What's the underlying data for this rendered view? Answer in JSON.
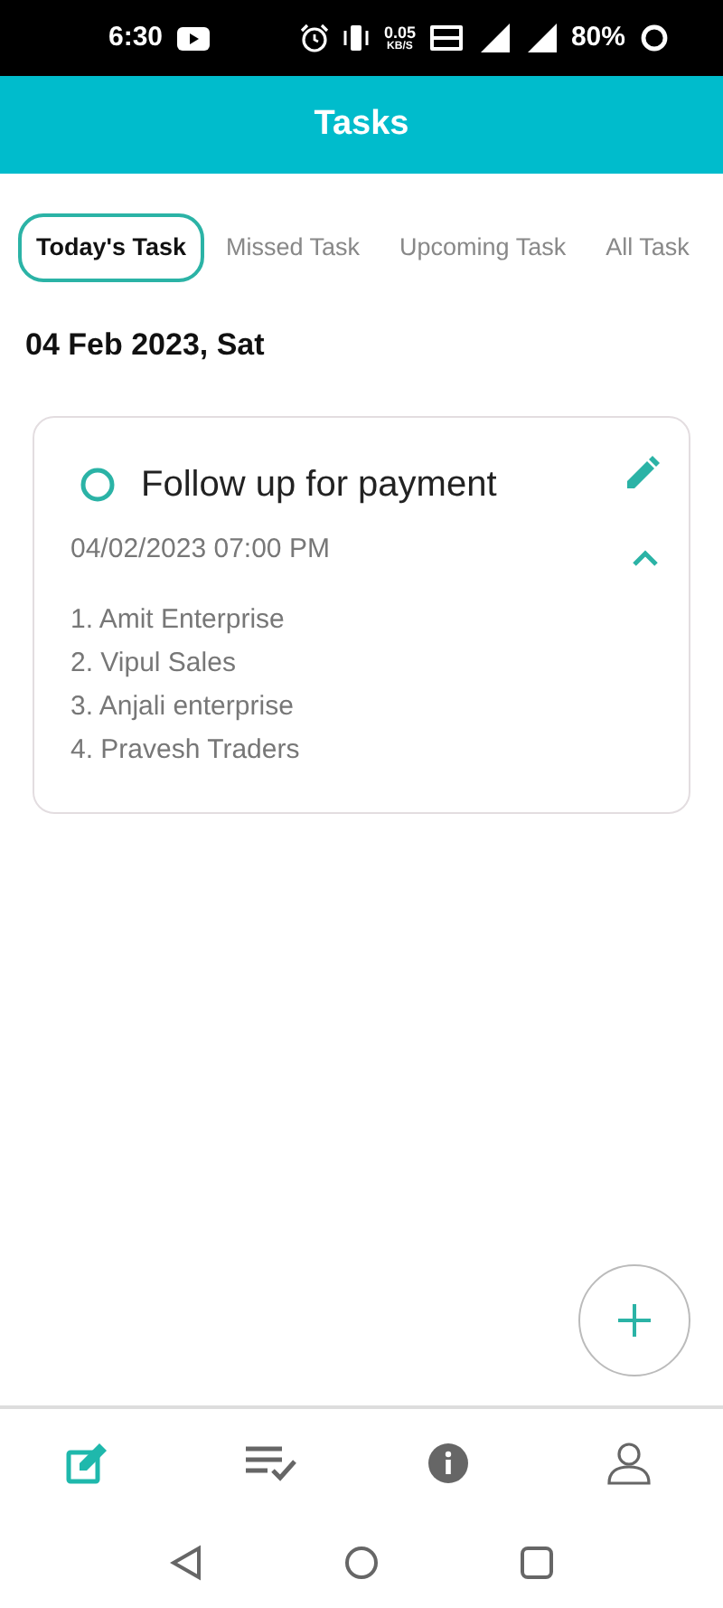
{
  "status_bar": {
    "time": "6:30",
    "speed": "0.05",
    "speed_unit": "KB/S",
    "battery": "80%"
  },
  "header": {
    "title": "Tasks"
  },
  "tabs": [
    {
      "label": "Today's Task",
      "selected": true
    },
    {
      "label": "Missed Task",
      "selected": false
    },
    {
      "label": "Upcoming Task",
      "selected": false
    },
    {
      "label": "All Task",
      "selected": false
    }
  ],
  "date_heading": "04 Feb 2023, Sat",
  "tasks": [
    {
      "title": "Follow up for payment",
      "done": false,
      "expanded": true,
      "datetime": "04/02/2023 07:00 PM",
      "items": [
        "1. Amit Enterprise",
        "2. Vipul Sales",
        "3. Anjali enterprise",
        "4. Pravesh Traders"
      ]
    }
  ],
  "bottom_nav": [
    {
      "kind": "edit",
      "selected": true
    },
    {
      "kind": "checklist",
      "selected": false
    },
    {
      "kind": "info",
      "selected": false
    },
    {
      "kind": "profile",
      "selected": false
    }
  ]
}
